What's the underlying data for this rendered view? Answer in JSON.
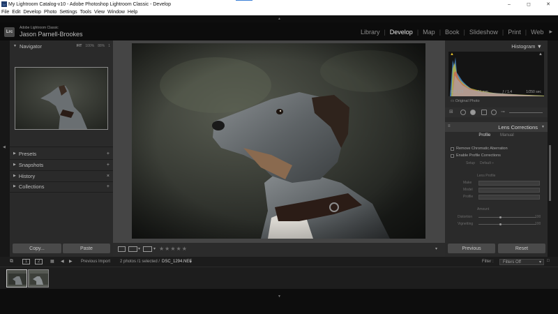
{
  "window": {
    "icon_text": "Lr",
    "title": "My Lightroom Catalog-v10 - Adobe Photoshop Lightroom Classic - Develop",
    "controls": [
      "–",
      "◻",
      "✕"
    ]
  },
  "menu": [
    "File",
    "Edit",
    "Develop",
    "Photo",
    "Settings",
    "Tools",
    "View",
    "Window",
    "Help"
  ],
  "identity": {
    "badge": "Lrc",
    "product": "Adobe Lightroom Classic",
    "user": "Jason Parnell-Brookes"
  },
  "modules": [
    "Library",
    "Develop",
    "Map",
    "Book",
    "Slideshow",
    "Print",
    "Web"
  ],
  "active_module": "Develop",
  "left_panel": {
    "navigator": {
      "title": "Navigator",
      "zoom": [
        "FIT",
        "100%",
        "88%",
        "1"
      ]
    },
    "sections": [
      {
        "title": "Presets",
        "action": "+"
      },
      {
        "title": "Snapshots",
        "action": "+"
      },
      {
        "title": "History",
        "action": "×"
      },
      {
        "title": "Collections",
        "action": "+"
      }
    ],
    "copy_label": "Copy...",
    "paste_label": "Paste"
  },
  "toolbar": {
    "stars": "★★★★★",
    "sort": "▾"
  },
  "histogram": {
    "title": "Histogram",
    "iso": "ISO 125",
    "focal": "50 mm",
    "aperture": "ƒ / 1.4",
    "shutter": "1/250 sec",
    "original_photo": "Original Photo"
  },
  "lens_corrections": {
    "title": "Lens Corrections",
    "tabs": [
      "Profile",
      "Manual"
    ],
    "active_tab": "Profile",
    "options": [
      "Remove Chromatic Aberration",
      "Enable Profile Corrections"
    ],
    "setup_label": "Setup",
    "setup_value": "Default ÷",
    "lens_profile_label": "Lens Profile",
    "fields": [
      "Make",
      "Model",
      "Profile"
    ],
    "amount_label": "Amount",
    "sliders": [
      {
        "label": "Distortion",
        "value": "100"
      },
      {
        "label": "Vignetting",
        "value": "100"
      }
    ]
  },
  "right_buttons": {
    "previous": "Previous",
    "reset": "Reset"
  },
  "filmstrip": {
    "views": [
      "1",
      "2"
    ],
    "source": "Previous Import",
    "status": "2 photos /1 selected /",
    "filename": "DSC_1294.NEF",
    "filter_label": "Filter :",
    "filter_value": "Filters Off"
  },
  "colors": {
    "panel": "#2a2a2a",
    "background": "#454545",
    "accent": "#3b7fd6"
  }
}
